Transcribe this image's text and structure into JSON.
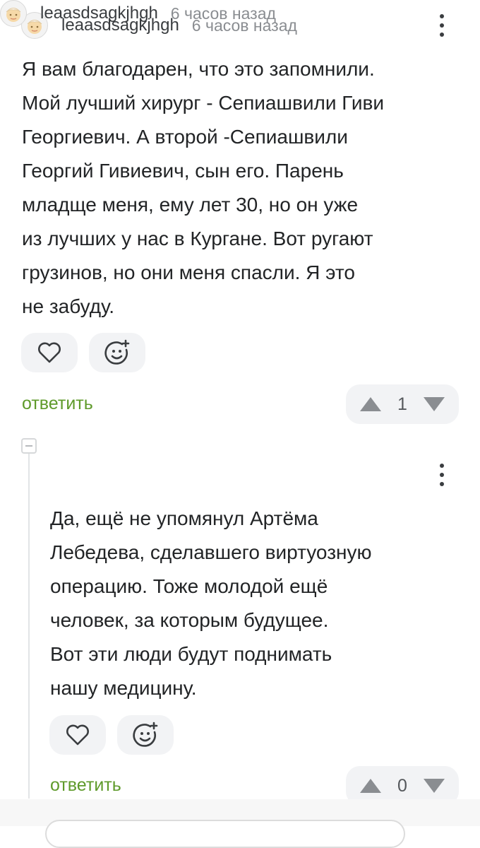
{
  "comments": [
    {
      "username": "leaasdsagkjhgh",
      "time": "6 часов назад",
      "text": "Я вам благодарен, что это запомнили.\nМой лучший хирург - Сепиашвили Гиви\nГеоргиевич. А второй -Сепиашвили\nГеоргий Гивиевич, сын его. Парень\nмладще меня, ему лет 30, но он уже\nиз лучших у нас в Кургане. Вот ругают\nгрузинов, но они меня спасли. Я это\nне забуду.",
      "reply_label": "ответить",
      "rating": "1"
    },
    {
      "username": "leaasdsagkjhgh",
      "time": "6 часов назад",
      "text": "Да, ещё не упомянул Артёма\nЛебедева, сделавшего виртуозную\nоперацию. Тоже молодой ещё\nчеловек, за которым будущее.\nВот эти люди будут поднимать\nнашу медицину.",
      "reply_label": "ответить",
      "rating": "0"
    }
  ],
  "icons": {
    "avatar": "avatar-icon",
    "more": "more-vertical-icon",
    "like": "heart-icon",
    "reaction": "smiley-add-icon",
    "upvote": "triangle-up-icon",
    "downvote": "triangle-down-icon",
    "collapse": "minus-square-icon"
  },
  "colors": {
    "reply_link": "#5e9a2a",
    "button_bg": "#f2f3f5",
    "icon": "#3a3d40",
    "vote_arrow": "#8a8d91"
  }
}
